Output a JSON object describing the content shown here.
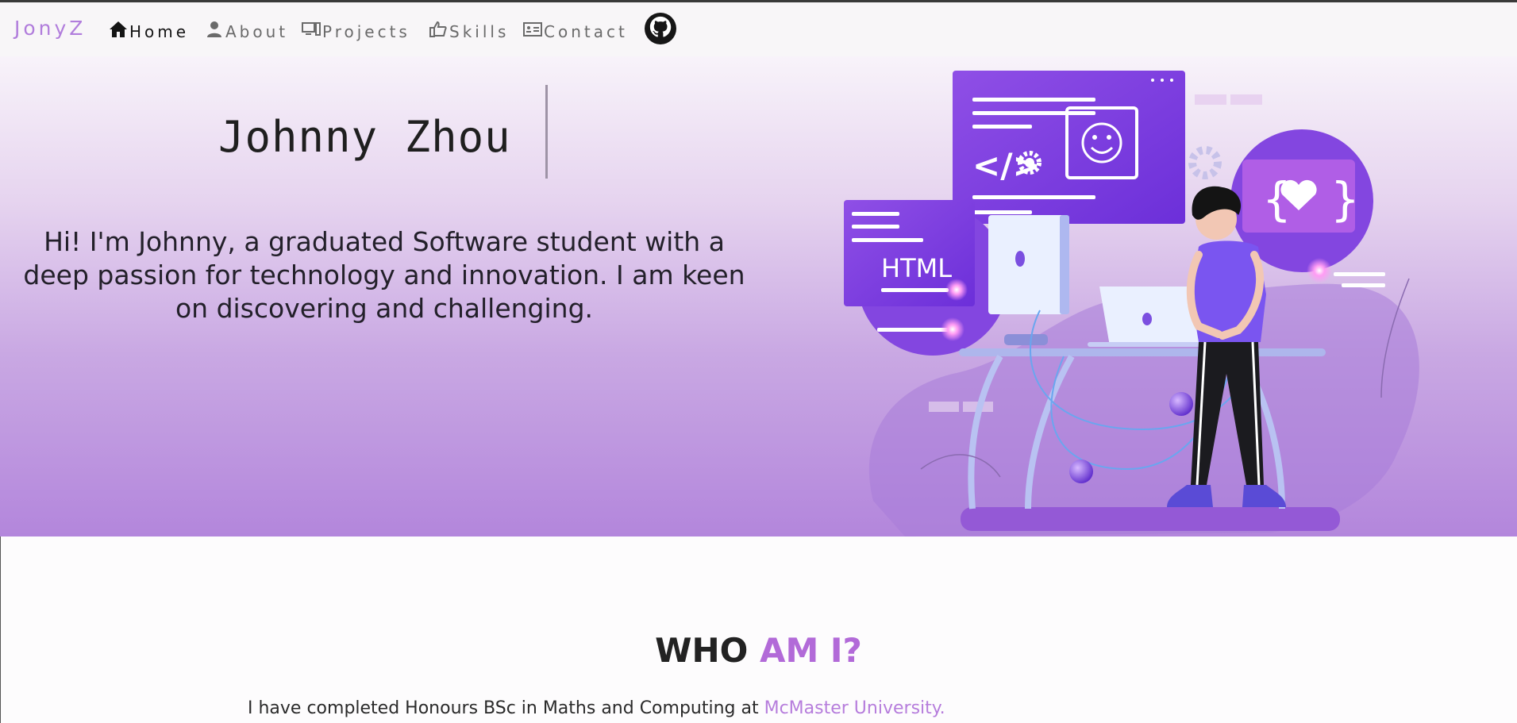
{
  "brand": "JonyZ",
  "nav": {
    "home": "Home",
    "about": "About",
    "projects": "Projects",
    "skills": "Skills",
    "contact": "Contact"
  },
  "hero": {
    "name": "Johnny Zhou",
    "intro": "Hi! I'm Johnny, a graduated Software student with a deep passion for technology and innovation. I am keen on discovering and challenging.",
    "illustration_label": "HTML"
  },
  "about": {
    "title_part1": "WHO",
    "title_part2": "AM I?",
    "text": "I have completed Honours BSc in Maths and Computing at ",
    "link_text": "McMaster University."
  },
  "colors": {
    "accent": "#b26ad8",
    "brand": "#b17ddc",
    "hero_bottom": "#b386dc"
  }
}
